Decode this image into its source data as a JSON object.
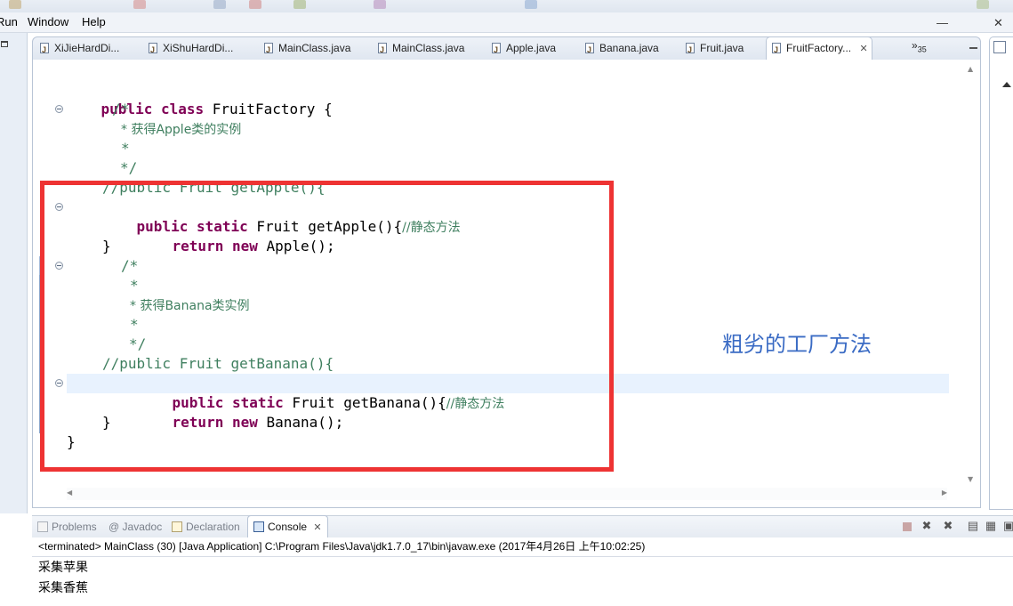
{
  "menu": {
    "items": [
      {
        "label": "Run",
        "mnemonic": "R"
      },
      {
        "label": "Window",
        "mnemonic": "W"
      },
      {
        "label": "Help",
        "mnemonic": "H"
      }
    ]
  },
  "editor": {
    "tabs": [
      {
        "label": "XiJieHardDi..."
      },
      {
        "label": "XiShuHardDi..."
      },
      {
        "label": "MainClass.java"
      },
      {
        "label": "MainClass.java"
      },
      {
        "label": "Apple.java"
      },
      {
        "label": "Banana.java"
      },
      {
        "label": "Fruit.java"
      },
      {
        "label": "FruitFactory...",
        "active": true
      }
    ],
    "overflow_label": "»",
    "overflow_count": "35",
    "code": {
      "l1_kw1": "public",
      "l1_kw2": "class",
      "l1_rest": " FruitFactory {",
      "l2": "/*",
      "l3": "* 获得Apple类的实例",
      "l4": "*",
      "l5": "*/",
      "l6": "//public Fruit getApple(){",
      "l7_kw1": "public",
      "l7_kw2": "static",
      "l7_rest": " Fruit getApple(){",
      "l7_cm": "//静态方法",
      "l8_kw1": "return",
      "l8_kw2": "new",
      "l8_rest": " Apple();",
      "l9": "}",
      "l10": "/*",
      "l11": "*",
      "l12": "* 获得Banana类实例",
      "l13": "*",
      "l14": "*/",
      "l15": "//public Fruit getBanana(){",
      "l16_kw1": "public",
      "l16_kw2": "static",
      "l16_rest": " Fruit getBanana(){",
      "l16_cm": "//静态方法",
      "l17_kw1": "return",
      "l17_kw2": "new",
      "l17_rest": " Banana();",
      "l18": "}",
      "l19": "}"
    },
    "annotation": "粗劣的工厂方法"
  },
  "console": {
    "tabs": [
      {
        "label": "Problems"
      },
      {
        "label": "Javadoc",
        "prefix": "@"
      },
      {
        "label": "Declaration"
      },
      {
        "label": "Console",
        "active": true
      }
    ],
    "status": "<terminated> MainClass (30) [Java Application] C:\\Program Files\\Java\\jdk1.7.0_17\\bin\\javaw.exe (2017年4月26日 上午10:02:25)",
    "output": [
      "采集苹果",
      "采集香蕉"
    ]
  },
  "colors": {
    "keyword": "#7f0055",
    "comment": "#3f7f5f",
    "highlight_box": "#ee3333",
    "annotation_text": "#3a6bc4",
    "current_line": "#e8f2fe"
  }
}
